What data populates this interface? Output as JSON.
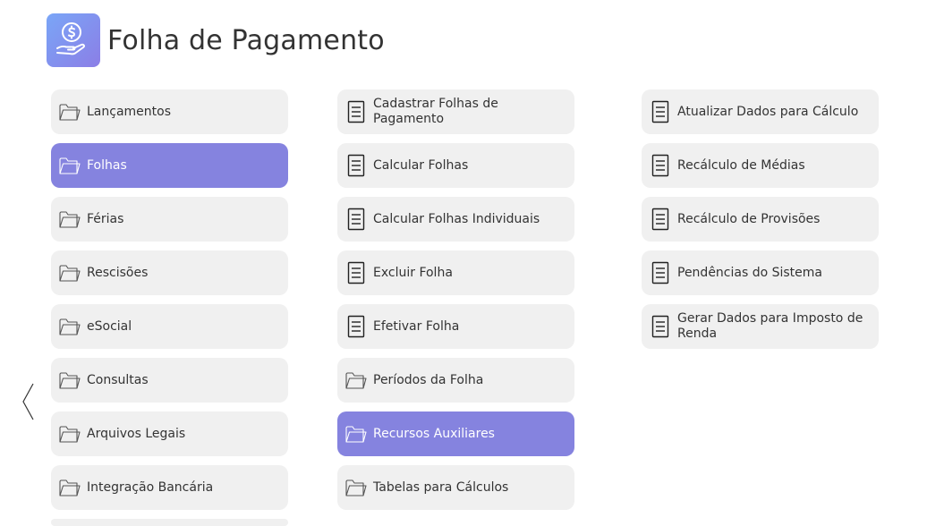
{
  "header": {
    "title": "Folha de Pagamento",
    "icon": "money-hand-icon"
  },
  "colors": {
    "active_tile": "#8583df",
    "tile": "#f0f0f0",
    "icon_gradient_start": "#7aa6f7",
    "icon_gradient_end": "#8b7ee6"
  },
  "menu": {
    "items": [
      {
        "label": "Lançamentos",
        "icon": "folder-icon"
      },
      {
        "label": "Folhas",
        "icon": "folder-icon",
        "selected": true
      },
      {
        "label": "Férias",
        "icon": "folder-icon"
      },
      {
        "label": "Rescisões",
        "icon": "folder-icon"
      },
      {
        "label": "eSocial",
        "icon": "folder-icon"
      },
      {
        "label": "Consultas",
        "icon": "folder-icon"
      },
      {
        "label": "Arquivos Legais",
        "icon": "folder-icon"
      },
      {
        "label": "Integração Bancária",
        "icon": "folder-icon"
      }
    ]
  },
  "folhas": {
    "items": [
      {
        "label": "Cadastrar Folhas de Pagamento",
        "icon": "document-icon"
      },
      {
        "label": "Calcular Folhas",
        "icon": "document-icon"
      },
      {
        "label": "Calcular Folhas Individuais",
        "icon": "document-icon"
      },
      {
        "label": "Excluir Folha",
        "icon": "document-icon"
      },
      {
        "label": "Efetivar Folha",
        "icon": "document-icon"
      },
      {
        "label": "Períodos da Folha",
        "icon": "folder-icon"
      },
      {
        "label": "Recursos Auxiliares",
        "icon": "folder-icon",
        "selected": true
      },
      {
        "label": "Tabelas para Cálculos",
        "icon": "folder-icon"
      }
    ]
  },
  "recursos": {
    "items": [
      {
        "label": "Atualizar Dados para Cálculo",
        "icon": "document-icon"
      },
      {
        "label": "Recálculo de Médias",
        "icon": "document-icon"
      },
      {
        "label": "Recálculo de Provisões",
        "icon": "document-icon"
      },
      {
        "label": "Pendências do Sistema",
        "icon": "document-icon"
      },
      {
        "label": "Gerar Dados para Imposto de Renda",
        "icon": "document-icon"
      }
    ]
  },
  "navigation": {
    "back_icon": "chevron-left-icon"
  }
}
